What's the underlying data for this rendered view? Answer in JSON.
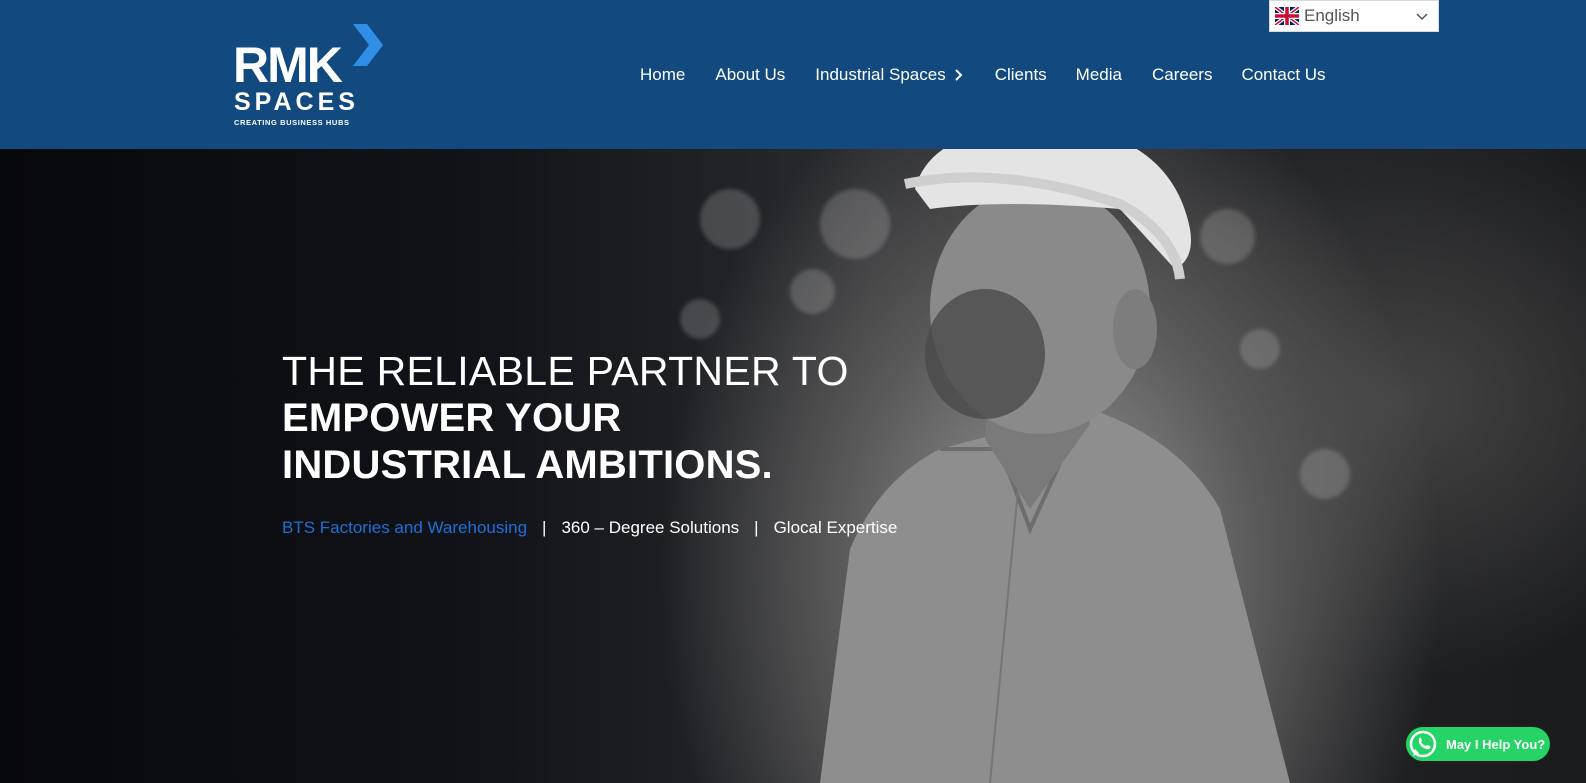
{
  "brand": {
    "name": "RMK",
    "sub": "SPACES",
    "tagline": "CREATING BUSINESS HUBS"
  },
  "nav": {
    "items": [
      "Home",
      "About Us",
      "Industrial Spaces",
      "Clients",
      "Media",
      "Careers",
      "Contact Us"
    ]
  },
  "language": {
    "selected": "English",
    "flag_icon": "uk-flag-icon"
  },
  "hero": {
    "line1": "THE RELIABLE PARTNER TO",
    "line2": "EMPOWER YOUR",
    "line3": "INDUSTRIAL AMBITIONS.",
    "sub_link": "BTS Factories and Warehousing",
    "separator": "|",
    "sub_item2": "360 – Degree Solutions",
    "sub_item3": "Glocal Expertise"
  },
  "whatsapp": {
    "label": "May I Help You?",
    "icon": "whatsapp-icon"
  },
  "colors": {
    "header_bg": "#124a7f",
    "accent_blue": "#1e6fd9",
    "whatsapp_green": "#25d366"
  }
}
